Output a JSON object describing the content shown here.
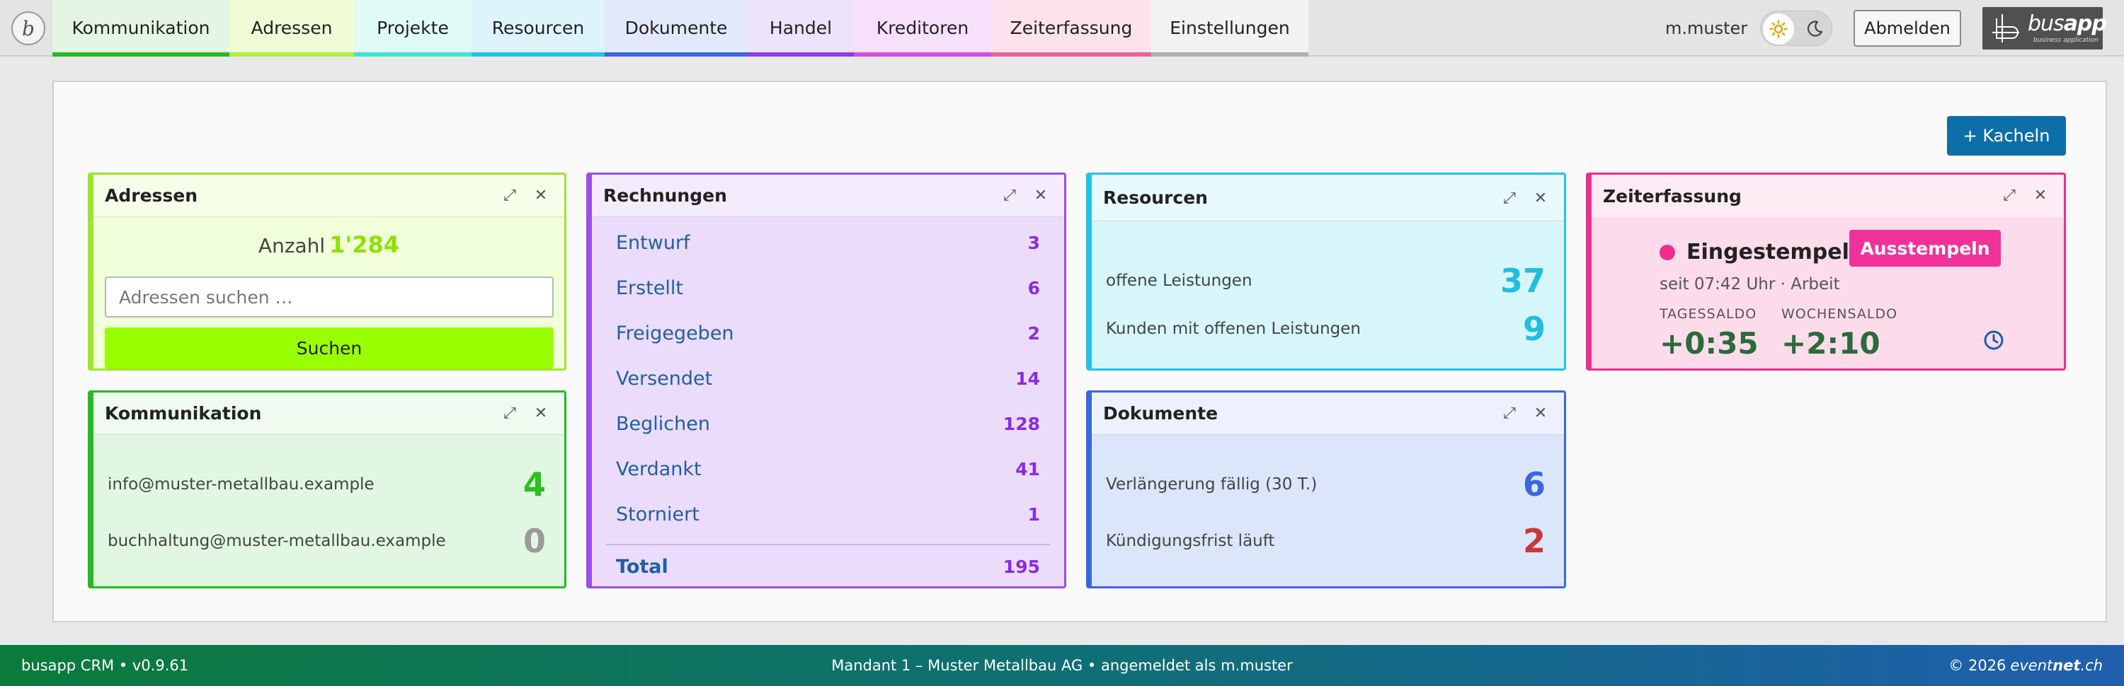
{
  "nav": {
    "logo_letter": "b",
    "tabs": [
      {
        "label": "Kommunikation",
        "bg": "#e4f5e4",
        "accent": "#22bb22"
      },
      {
        "label": "Adressen",
        "bg": "#effcd6",
        "accent": "#aef03c"
      },
      {
        "label": "Projekte",
        "bg": "#e0fbf6",
        "accent": "#3fe3d2"
      },
      {
        "label": "Resourcen",
        "bg": "#def4fb",
        "accent": "#22c3e6"
      },
      {
        "label": "Dokumente",
        "bg": "#e2e9fb",
        "accent": "#3a66e0"
      },
      {
        "label": "Handel",
        "bg": "#ede3fb",
        "accent": "#8a3cf0"
      },
      {
        "label": "Kreditoren",
        "bg": "#f6e0fa",
        "accent": "#d84ae8"
      },
      {
        "label": "Zeiterfassung",
        "bg": "#fce2ec",
        "accent": "#f0609a"
      },
      {
        "label": "Einstellungen",
        "bg": "#f2f2f2",
        "accent": "#b0b0b0"
      }
    ],
    "username": "m.muster",
    "logout_label": "Abmelden",
    "brand_main": "bus",
    "brand_bold": "app",
    "brand_sub": "business application"
  },
  "toolbar": {
    "add_tile_label": "+ Kacheln"
  },
  "cards": {
    "adressen": {
      "title": "Adressen",
      "count_label": "Anzahl",
      "count_value": "1'284",
      "search_placeholder": "Adressen suchen …",
      "search_button": "Suchen",
      "accent": "#9be62a",
      "bg": "#f0ffd9"
    },
    "kommunikation": {
      "title": "Kommunikation",
      "accent": "#22bb22",
      "bg": "#e1f7e1",
      "rows": [
        {
          "label": "info@muster-metallbau.example",
          "value": "4",
          "color": "#2fbf1f"
        },
        {
          "label": "buchhaltung@muster-metallbau.example",
          "value": "0",
          "color": "#9a9a9a"
        }
      ]
    },
    "rechnungen": {
      "title": "Rechnungen",
      "accent": "#9b4ee8",
      "bg": "#ecdcfb",
      "rows": [
        {
          "label": "Entwurf",
          "value": "3"
        },
        {
          "label": "Erstellt",
          "value": "6"
        },
        {
          "label": "Freigegeben",
          "value": "2"
        },
        {
          "label": "Versendet",
          "value": "14"
        },
        {
          "label": "Beglichen",
          "value": "128"
        },
        {
          "label": "Verdankt",
          "value": "41"
        },
        {
          "label": "Storniert",
          "value": "1"
        }
      ],
      "total_label": "Total",
      "total_value": "195"
    },
    "resourcen": {
      "title": "Resourcen",
      "accent": "#22c3e6",
      "bg": "#d6f6fb",
      "rows": [
        {
          "label": "offene Leistungen",
          "value": "37",
          "color": "#1fbde0"
        },
        {
          "label": "Kunden mit offenen Leistungen",
          "value": "9",
          "color": "#1fbde0"
        }
      ]
    },
    "dokumente": {
      "title": "Dokumente",
      "accent": "#3a66e0",
      "bg": "#dce6fb",
      "rows": [
        {
          "label": "Verlängerung fällig (30 T.)",
          "value": "6",
          "color": "#3a66e0"
        },
        {
          "label": "Kündigungsfrist läuft",
          "value": "2",
          "color": "#c7383a"
        }
      ]
    },
    "zeiterfassung": {
      "title": "Zeiterfassung",
      "accent": "#ee2d8f",
      "bg": "#fcdcea",
      "status": "Eingestempelt",
      "button": "Ausstempeln",
      "since": "seit 07:42 Uhr · Arbeit",
      "day_label": "TAGESSALDO",
      "day_value": "+0:35",
      "week_label": "WOCHENSALDO",
      "week_value": "+2:10"
    }
  },
  "footer": {
    "left": "busapp CRM • v0.9.61",
    "center": "Mandant 1 – Muster Metallbau AG • angemeldet als m.muster",
    "copyright": "© 2026",
    "brand_a": "event",
    "brand_b": "net",
    "brand_c": ".ch"
  }
}
